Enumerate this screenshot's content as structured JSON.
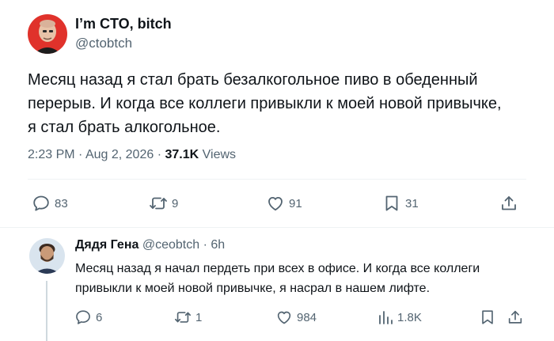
{
  "main_tweet": {
    "display_name": "I’m CTO, bitch",
    "handle": "@ctobtch",
    "text_lines": [
      "Месяц назад я стал брать безалкогольное пиво в обеденный",
      "перерыв. И когда все коллеги привыкли к моей новой привычке,",
      "я стал брать алкогольное."
    ],
    "time": "2:23 PM",
    "date": "Aug 2, 2026",
    "views_count": "37.1K",
    "views_label": "Views",
    "actions": {
      "replies": "83",
      "reposts": "9",
      "likes": "91",
      "bookmarks": "31"
    }
  },
  "reply_tweet": {
    "display_name": "Дядя Гена",
    "handle": "@ceobtch",
    "age": "6h",
    "text_lines": [
      "Месяц назад я начал пердеть при всех в офисе. И когда все коллеги",
      "привыкли к моей новой привычке, я насрал в нашем лифте."
    ],
    "actions": {
      "replies": "6",
      "reposts": "1",
      "likes": "984",
      "views": "1.8K"
    }
  },
  "icons": {
    "reply": "speech-bubble-icon",
    "repost": "repost-arrows-icon",
    "like": "heart-icon",
    "bookmark": "bookmark-icon",
    "share": "share-upload-icon",
    "views": "bar-chart-icon"
  },
  "colors": {
    "text_primary": "#0f1419",
    "text_secondary": "#536471",
    "divider": "#eff3f4",
    "main_avatar_bg": "#e0322b"
  }
}
